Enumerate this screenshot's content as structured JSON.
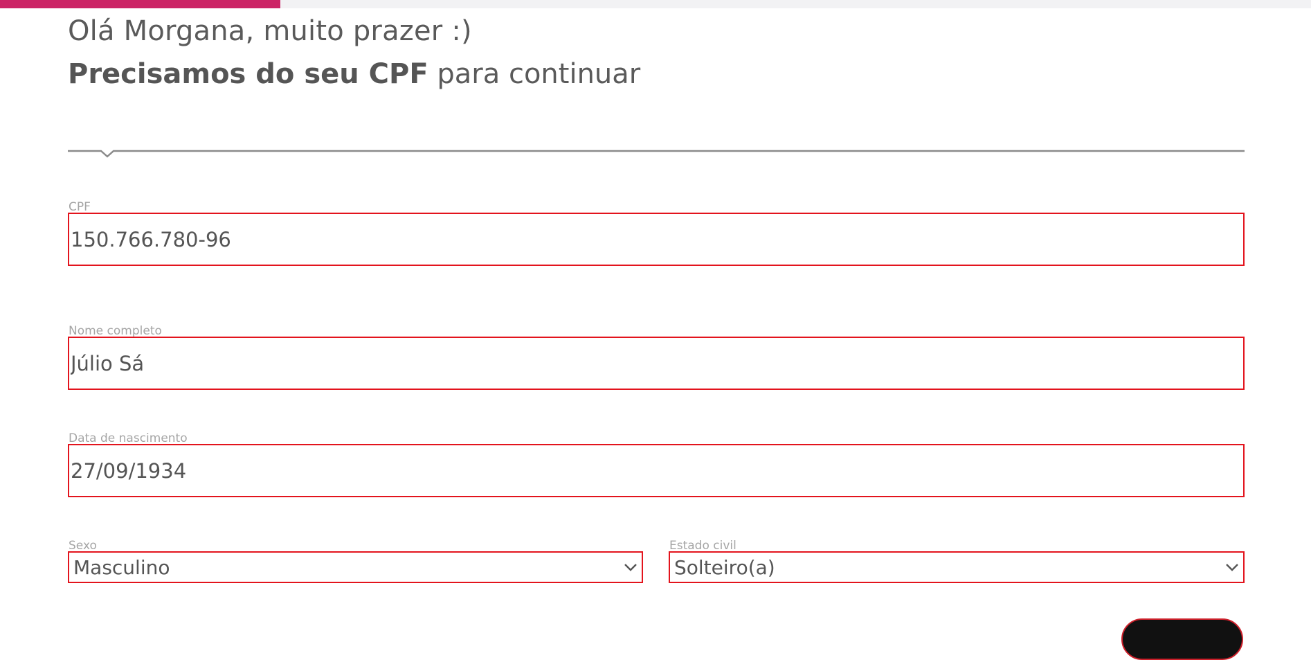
{
  "progress": {
    "fraction": 0.214
  },
  "header": {
    "greeting": "Olá Morgana, muito prazer :)",
    "subtitle_bold": "Precisamos do seu CPF",
    "subtitle_rest": " para continuar"
  },
  "form": {
    "cpf": {
      "label": "CPF",
      "value": "150.766.780-96"
    },
    "nome": {
      "label": "Nome completo",
      "value": "Júlio Sá"
    },
    "nascimento": {
      "label": "Data de nascimento",
      "value": "27/09/1934"
    },
    "sexo": {
      "label": "Sexo",
      "selected": "Masculino",
      "icon": "chevron-down-icon"
    },
    "estado_civil": {
      "label": "Estado civil",
      "selected": "Solteiro(a)",
      "icon": "chevron-down-icon"
    }
  },
  "colors": {
    "accent": "#cc2466",
    "field_border": "#e3141d",
    "text": "#555555",
    "label": "#a5a5a5"
  }
}
